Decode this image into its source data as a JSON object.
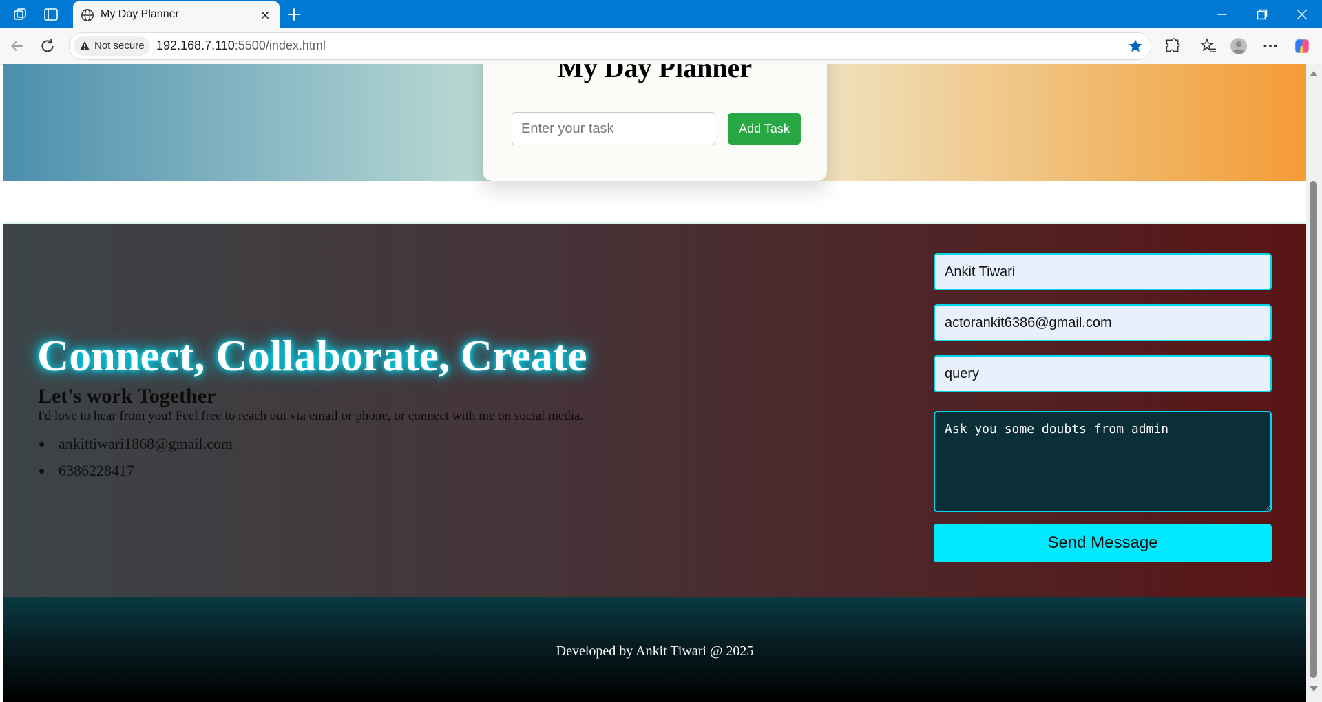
{
  "browser": {
    "tab_title": "My Day Planner",
    "not_secure_label": "Not secure",
    "url_host": "192.168.7.110",
    "url_path": ":5500/index.html",
    "accent_color": "#0078d4"
  },
  "planner": {
    "title": "My Day Planner",
    "task_placeholder": "Enter your task",
    "add_task_label": "Add Task",
    "add_task_color": "#28a745"
  },
  "contact": {
    "headline": "Connect, Collaborate, Create",
    "subheading": "Let's work Together",
    "intro": "I'd love to hear from you! Feel free to reach out via email or phone, or connect with me on social media.",
    "email": "ankittiwari1868@gmail.com",
    "phone": "6386228417",
    "form": {
      "name_value": "Ankit Tiwari",
      "email_value": "actorankit6386@gmail.com",
      "subject_value": "query",
      "message_value": "Ask you some doubts from admin",
      "send_label": "Send Message",
      "send_color": "#00e9ff"
    }
  },
  "footer": {
    "text": "Developed by Ankit Tiwari @ 2025"
  }
}
